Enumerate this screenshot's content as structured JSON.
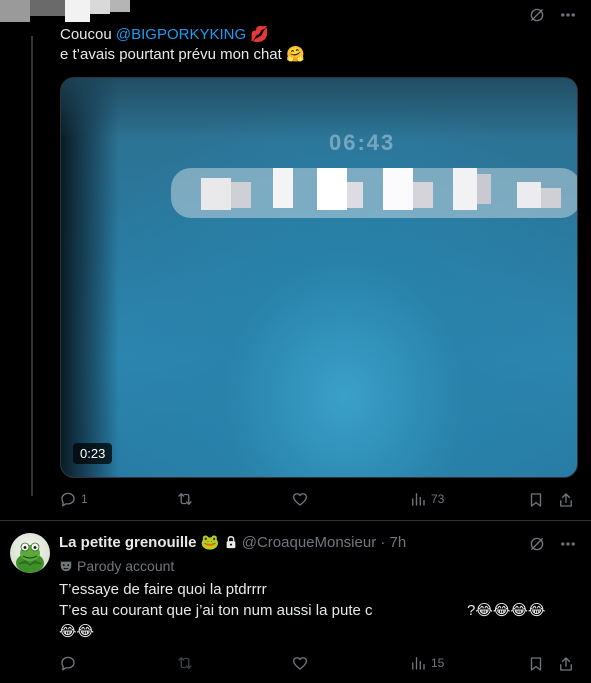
{
  "tweet1": {
    "line1_prefix": "Coucou ",
    "mention": "@BIGPORKYKING",
    "line1_emoji": "💋",
    "line2": "e t’avais pourtant prévu mon chat",
    "line2_emoji": "🤗",
    "video_time": "0:23",
    "video_overlay_text": "06:43",
    "replies": "1",
    "views": "73"
  },
  "tweet2": {
    "name": "La petite grenouille",
    "name_emoji": "🐸",
    "handle": "@CroaqueMonsieur",
    "separator": "·",
    "time": "7h",
    "parody_label": "Parody account",
    "line1": "T’essaye de faire quoi la ptdrrrr",
    "line2_start": "T’es au courant que j’ai ton num aussi la pute c",
    "line2_end": "?",
    "line2_emojis": "😂😂😂😂",
    "line3_emojis": "😂😂",
    "views": "15"
  },
  "icons": {
    "grok": "grok-icon",
    "more": "more-dots-icon",
    "reply": "reply-icon",
    "retweet": "retweet-icon",
    "like": "like-icon",
    "views": "views-icon",
    "bookmark": "bookmark-icon",
    "share": "share-icon",
    "parody": "parody-mask-icon",
    "lock": "lock-icon"
  },
  "colors": {
    "background": "#000000",
    "text": "#e7e9ea",
    "muted": "#71767b",
    "link": "#1d9bf0"
  }
}
